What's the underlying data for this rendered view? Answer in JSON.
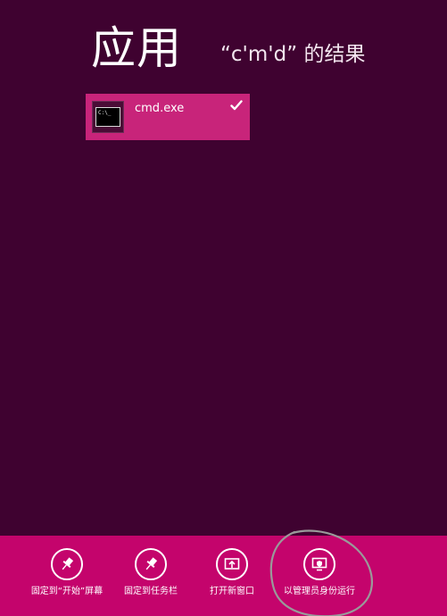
{
  "header": {
    "title": "应用",
    "subtitle": "“c'm'd” 的结果"
  },
  "results": [
    {
      "label": "cmd.exe",
      "icon": "command-prompt-icon",
      "icon_text": "C:\\_",
      "selected": true
    }
  ],
  "appbar": {
    "buttons": [
      {
        "label": "固定到“开始”屏幕",
        "icon": "pin-icon"
      },
      {
        "label": "固定到任务栏",
        "icon": "pin-icon"
      },
      {
        "label": "打开新窗口",
        "icon": "open-new-window-icon"
      },
      {
        "label": "以管理员身份运行",
        "icon": "run-as-admin-icon"
      }
    ]
  },
  "colors": {
    "background": "#3f0230",
    "tile": "#c8247a",
    "appbar": "#c4046c",
    "annotation": "#9a9a9a"
  }
}
